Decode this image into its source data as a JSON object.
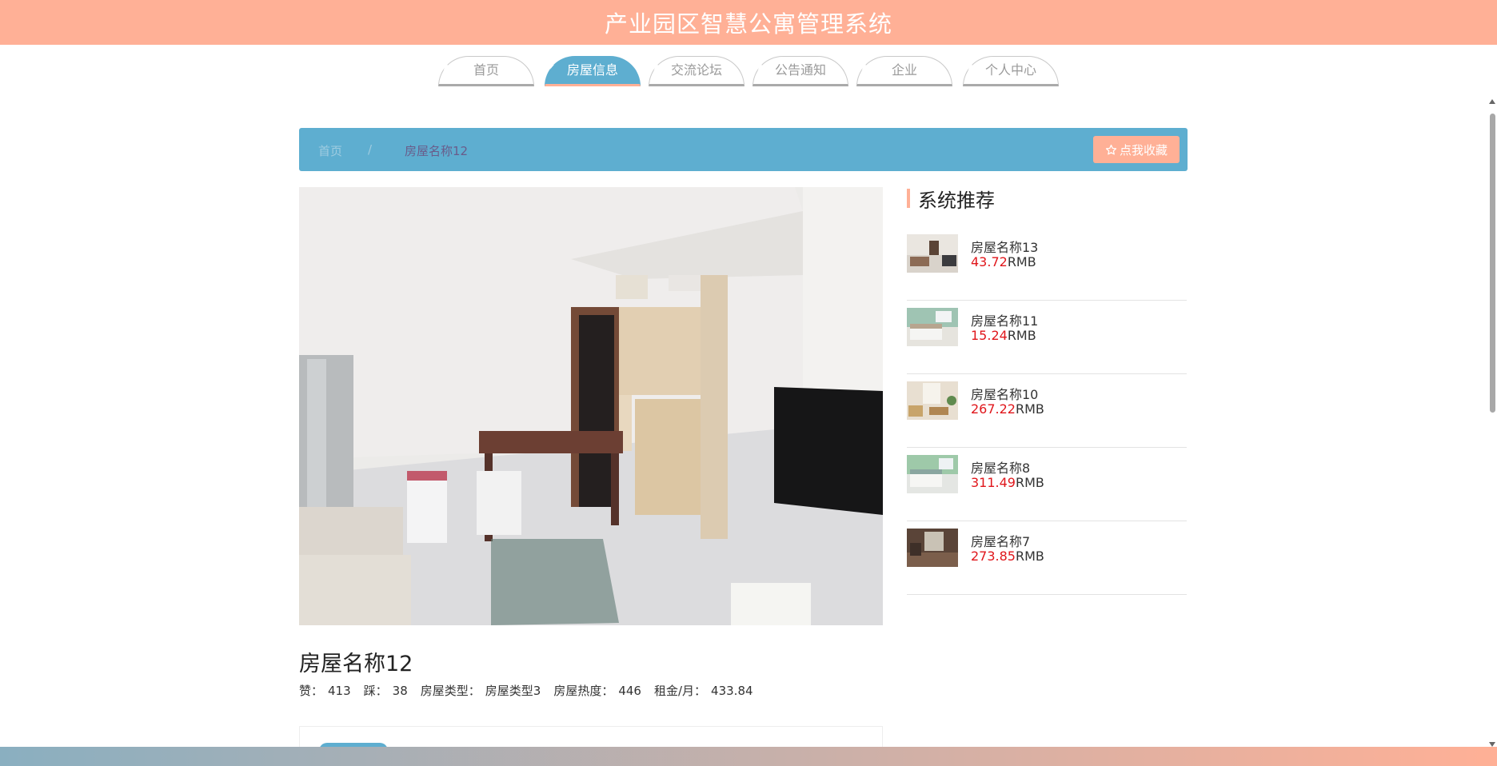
{
  "header": {
    "title": "产业园区智慧公寓管理系统"
  },
  "nav": {
    "tabs": [
      {
        "label": "首页"
      },
      {
        "label": "房屋信息"
      },
      {
        "label": "交流论坛"
      },
      {
        "label": "公告通知"
      },
      {
        "label": "企业"
      },
      {
        "label": "个人中心"
      }
    ],
    "active_tab": "房屋信息"
  },
  "breadcrumb": {
    "home": "首页",
    "separator": "/",
    "current": "房屋名称12"
  },
  "favorite_button": {
    "icon": "star-outline-icon",
    "label": "点我收藏"
  },
  "detail": {
    "title": "房屋名称12",
    "likes_label": "赞：",
    "likes": "413",
    "dislikes_label": "踩：",
    "dislikes": "38",
    "type_label": "房屋类型：",
    "type": "房屋类型3",
    "heat_label": "房屋热度：",
    "heat": "446",
    "rent_label": "租金/月：",
    "rent": "433.84"
  },
  "recommend": {
    "heading": "系统推荐",
    "currency": "RMB",
    "items": [
      {
        "name": "房屋名称13",
        "price": "43.72"
      },
      {
        "name": "房屋名称11",
        "price": "15.24"
      },
      {
        "name": "房屋名称10",
        "price": "267.22"
      },
      {
        "name": "房屋名称8",
        "price": "311.49"
      },
      {
        "name": "房屋名称7",
        "price": "273.85"
      }
    ]
  },
  "colors": {
    "brand": "#ffb096",
    "accent": "#5eaed0",
    "price": "#e0161b"
  }
}
